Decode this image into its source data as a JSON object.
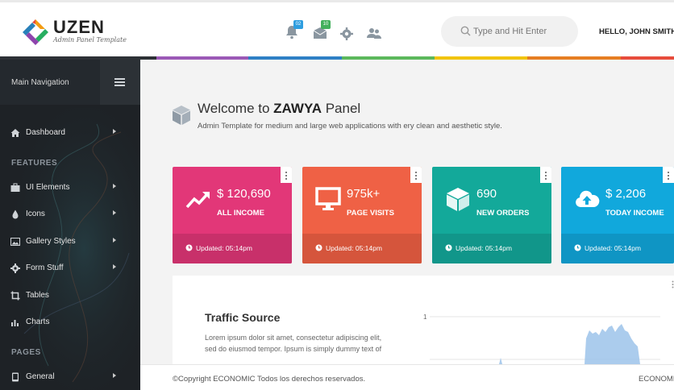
{
  "header": {
    "logo_text": "UZEN",
    "logo_subtitle": "Admin Panel Template",
    "notifications_badge": "02",
    "messages_badge": "10",
    "search_placeholder": "Type and Hit Enter",
    "greeting": "HELLO, JOHN SMITH!"
  },
  "colors": {
    "accent_bar": [
      "#2d3136",
      "#9b59b6",
      "#2f80c5",
      "#5cb85c",
      "#f1c40f",
      "#e67e22",
      "#e74c3c"
    ],
    "income": "#e23778",
    "visits": "#ef6145",
    "orders": "#13a99a",
    "today_income": "#11a8dc"
  },
  "sidebar": {
    "header_label": "Main Navigation",
    "items_top": [
      {
        "label": "Dashboard",
        "icon": "home-icon"
      }
    ],
    "section_features": "FEATURES",
    "items_features": [
      {
        "label": "UI Elements",
        "icon": "briefcase-icon"
      },
      {
        "label": "Icons",
        "icon": "drop-icon"
      },
      {
        "label": "Gallery Styles",
        "icon": "image-icon"
      },
      {
        "label": "Form Stuff",
        "icon": "gear-icon"
      },
      {
        "label": "Tables",
        "icon": "crop-icon"
      },
      {
        "label": "Charts",
        "icon": "bar-chart-icon"
      }
    ],
    "section_pages": "PAGES",
    "items_pages": [
      {
        "label": "General",
        "icon": "tablet-icon"
      }
    ]
  },
  "welcome": {
    "title_prefix": "Welcome to ",
    "title_bold": "ZAWYA",
    "title_suffix": " Panel",
    "subtitle": "Admin Template for medium and large web applications with ery clean and aesthetic style."
  },
  "cards": [
    {
      "value": "$ 120,690",
      "caption": "ALL INCOME",
      "updated": "Updated: 05:14pm",
      "icon": "trend-up-icon"
    },
    {
      "value": "975k+",
      "caption": "PAGE VISITS",
      "updated": "Updated: 05:14pm",
      "icon": "monitor-icon"
    },
    {
      "value": "690",
      "caption": "NEW ORDERS",
      "updated": "Updated: 05:14pm",
      "icon": "cube-icon"
    },
    {
      "value": "$ 2,206",
      "caption": "TODAY INCOME",
      "updated": "Updated: 05:14pm",
      "icon": "cloud-upload-icon"
    }
  ],
  "traffic": {
    "title": "Traffic Source",
    "text": "Lorem ipsum dolor sit amet, consectetur adipiscing elit, sed do eiusmod tempor. Ipsum is simply dummy text of",
    "axis_label": "1"
  },
  "footer": {
    "copyright": "©Copyright ECONOMIC Todos los derechos reservados.",
    "brand": "ECONOMIC"
  }
}
